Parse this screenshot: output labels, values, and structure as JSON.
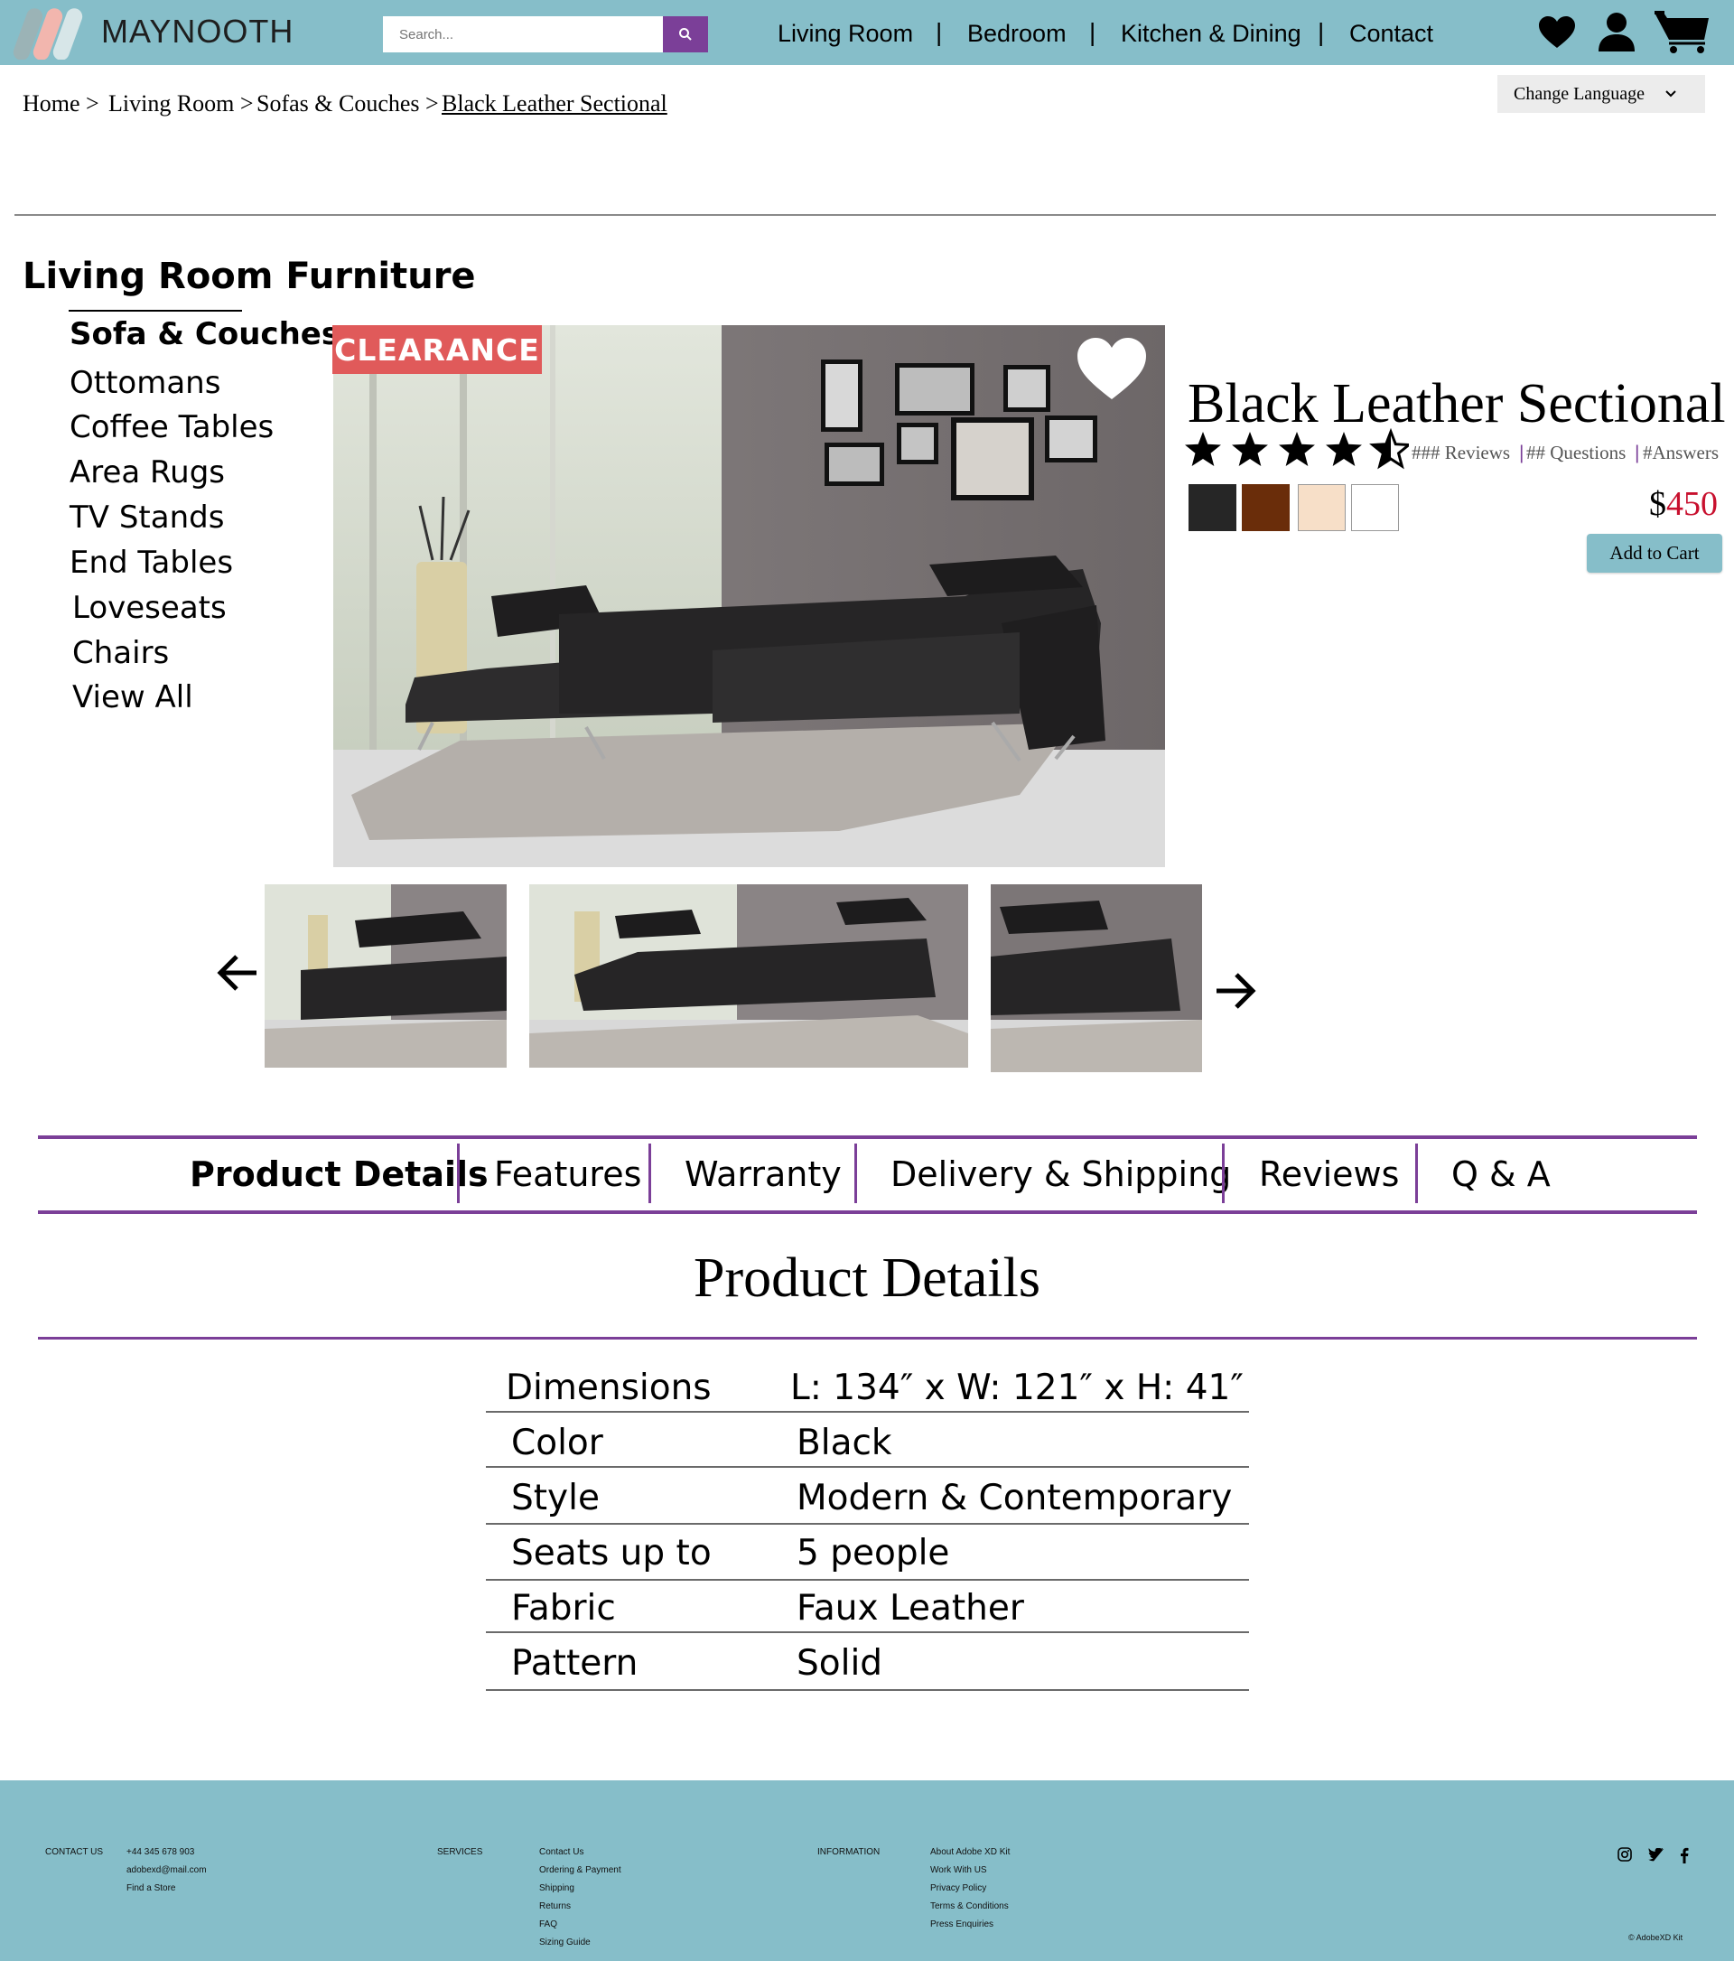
{
  "header": {
    "brand": "MAYNOOTH",
    "search_placeholder": "Search...",
    "nav": [
      "Living Room",
      "Bedroom",
      "Kitchen & Dining",
      "Contact"
    ],
    "separator": "|"
  },
  "breadcrumb": [
    "Home >",
    "Living Room >",
    "Sofas & Couches >",
    "Black Leather Sectional"
  ],
  "language_button": "Change Language",
  "sidebar": {
    "title": "Living Room Furniture",
    "items": [
      "Sofa & Couches",
      "Ottomans",
      "Coffee Tables",
      "Area Rugs",
      "TV Stands",
      "End Tables",
      "Loveseats",
      "Chairs",
      "View All"
    ]
  },
  "product": {
    "badge": "CLEARANCE",
    "title": "Black Leather Sectional",
    "rating": 4.5,
    "reviews": "### Reviews",
    "questions": "## Questions",
    "answers": "#Answers",
    "meta_sep": "|",
    "swatches": [
      "#262626",
      "#6a2d0a",
      "#f7dfc8",
      "#ffffff"
    ],
    "price_currency": "$",
    "price_value": "450",
    "add_to_cart": "Add to Cart"
  },
  "tabs": [
    "Product Details",
    "Features",
    "Warranty",
    "Delivery & Shipping",
    "Reviews",
    "Q & A"
  ],
  "details": {
    "heading": "Product Details",
    "rows": [
      {
        "label": "Dimensions",
        "value": "L: 134″ x W: 121″ x H: 41″"
      },
      {
        "label": "Color",
        "value": "Black"
      },
      {
        "label": "Style",
        "value": "Modern & Contemporary"
      },
      {
        "label": "Seats up to",
        "value": "5 people"
      },
      {
        "label": "Fabric",
        "value": "Faux Leather"
      },
      {
        "label": "Pattern",
        "value": "Solid"
      }
    ]
  },
  "footer": {
    "contact": {
      "heading": "CONTACT US",
      "items": [
        "+44 345 678 903",
        "adobexd@mail.com",
        "Find a Store"
      ]
    },
    "services": {
      "heading": "SERVICES",
      "items": [
        "Contact Us",
        "Ordering & Payment",
        "Shipping",
        "Returns",
        "FAQ",
        "Sizing Guide"
      ]
    },
    "information": {
      "heading": "INFORMATION",
      "items": [
        "About Adobe XD Kit",
        "Work With US",
        "Privacy Policy",
        "Terms & Conditions",
        "Press Enquiries"
      ]
    },
    "copyright": "© AdobeXD Kit"
  },
  "colors": {
    "header": "#86bec9",
    "accent": "#7b3f98",
    "price": "#c8102e",
    "badge": "#e05a5a"
  }
}
